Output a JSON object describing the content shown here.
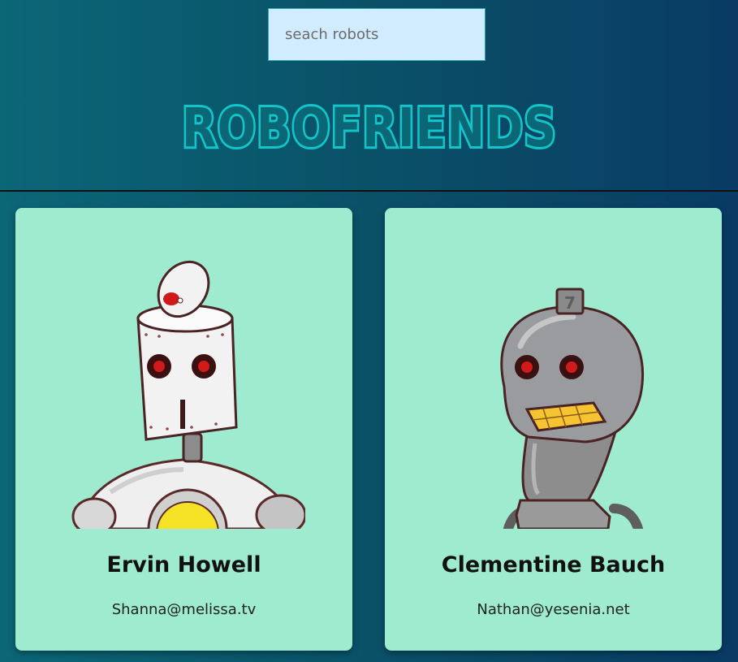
{
  "search": {
    "placeholder": "seach robots"
  },
  "app": {
    "title": "ROBOFRIENDS"
  },
  "robots": [
    {
      "name": "Ervin Howell",
      "email": "Shanna@melissa.tv",
      "image_icon": "robot-avatar-icon"
    },
    {
      "name": "Clementine Bauch",
      "email": "Nathan@yesenia.net",
      "image_icon": "robot-avatar-icon"
    }
  ],
  "colors": {
    "background_start": "#0b6676",
    "background_end": "#093b64",
    "card": "#9eebcf",
    "title": "#12c5c9",
    "search_bg": "#d2ecff"
  }
}
